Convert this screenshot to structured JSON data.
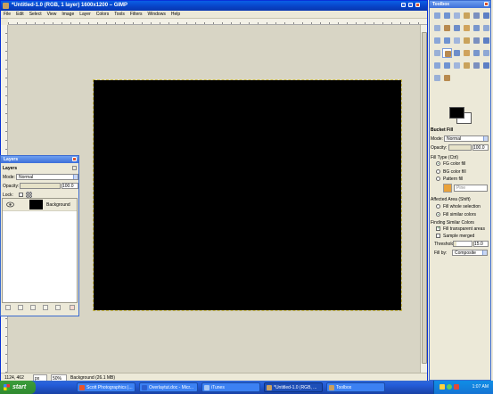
{
  "main_window": {
    "title": "*Untitled-1.0 (RGB, 1 layer) 1600x1200 – GIMP",
    "menu": [
      "File",
      "Edit",
      "Select",
      "View",
      "Image",
      "Layer",
      "Colors",
      "Tools",
      "Filters",
      "Windows",
      "Help"
    ]
  },
  "statusbar": {
    "coords": "1124, 462",
    "unit": "px",
    "zoom": "50%",
    "message": "Background (26.1 MB)"
  },
  "layers_dialog": {
    "title": "Layers",
    "tab": "Layers",
    "mode_label": "Mode:",
    "mode_value": "Normal",
    "opacity_label": "Opacity:",
    "opacity_value": "100.0",
    "lock_label": "Lock:",
    "layers": [
      {
        "name": "Background"
      }
    ]
  },
  "toolbox": {
    "title": "Toolbox",
    "tool_icons": [
      "rect-select-icon",
      "ellipse-select-icon",
      "free-select-icon",
      "fuzzy-select-icon",
      "select-by-color-icon",
      "scissors-icon",
      "paths-icon",
      "color-picker-icon",
      "zoom-icon",
      "measure-icon",
      "move-icon",
      "align-icon",
      "crop-icon",
      "rotate-icon",
      "scale-icon",
      "shear-icon",
      "perspective-icon",
      "flip-icon",
      "text-icon",
      "bucket-fill-icon",
      "blend-icon",
      "pencil-icon",
      "paintbrush-icon",
      "eraser-icon",
      "airbrush-icon",
      "ink-icon",
      "clone-icon",
      "heal-icon",
      "perspective-clone-icon",
      "smudge-icon",
      "blur-icon",
      "dodge-burn-icon"
    ],
    "active_tool": "bucket-fill-icon"
  },
  "tool_options": {
    "title": "Bucket Fill",
    "mode_label": "Mode:",
    "mode_value": "Normal",
    "opacity_label": "Opacity:",
    "opacity_value": "100.0",
    "fill_type_label": "Fill Type  (Ctrl)",
    "fill_types": [
      "FG color fill",
      "BG color fill",
      "Pattern fill"
    ],
    "selected_fill_type": 0,
    "pattern_name": "Pine",
    "affected_area_label": "Affected Area  (Shift)",
    "affected_areas": [
      "Fill whole selection",
      "Fill similar colors"
    ],
    "selected_area": 1,
    "finding_label": "Finding Similar Colors",
    "fill_transparent_label": "Fill transparent areas",
    "fill_transparent_checked": true,
    "sample_merged_label": "Sample merged",
    "sample_merged_checked": false,
    "threshold_label": "Threshold:",
    "threshold_value": "15.0",
    "fill_by_label": "Fill by:",
    "fill_by_value": "Composite"
  },
  "taskbar": {
    "start_label": "start",
    "tasks": [
      {
        "label": "Scott Photographics |...",
        "active": false
      },
      {
        "label": "Overlaytut.doc - Micr...",
        "active": false
      },
      {
        "label": "iTunes",
        "active": false
      },
      {
        "label": "*Untitled-1.0 (RGB, ...",
        "active": true
      },
      {
        "label": "Toolbox",
        "active": false
      }
    ],
    "clock": "1:07 AM"
  },
  "colors": {
    "fg": "#000000",
    "bg": "#ffffff",
    "xp_blue": "#0a5fe6"
  }
}
